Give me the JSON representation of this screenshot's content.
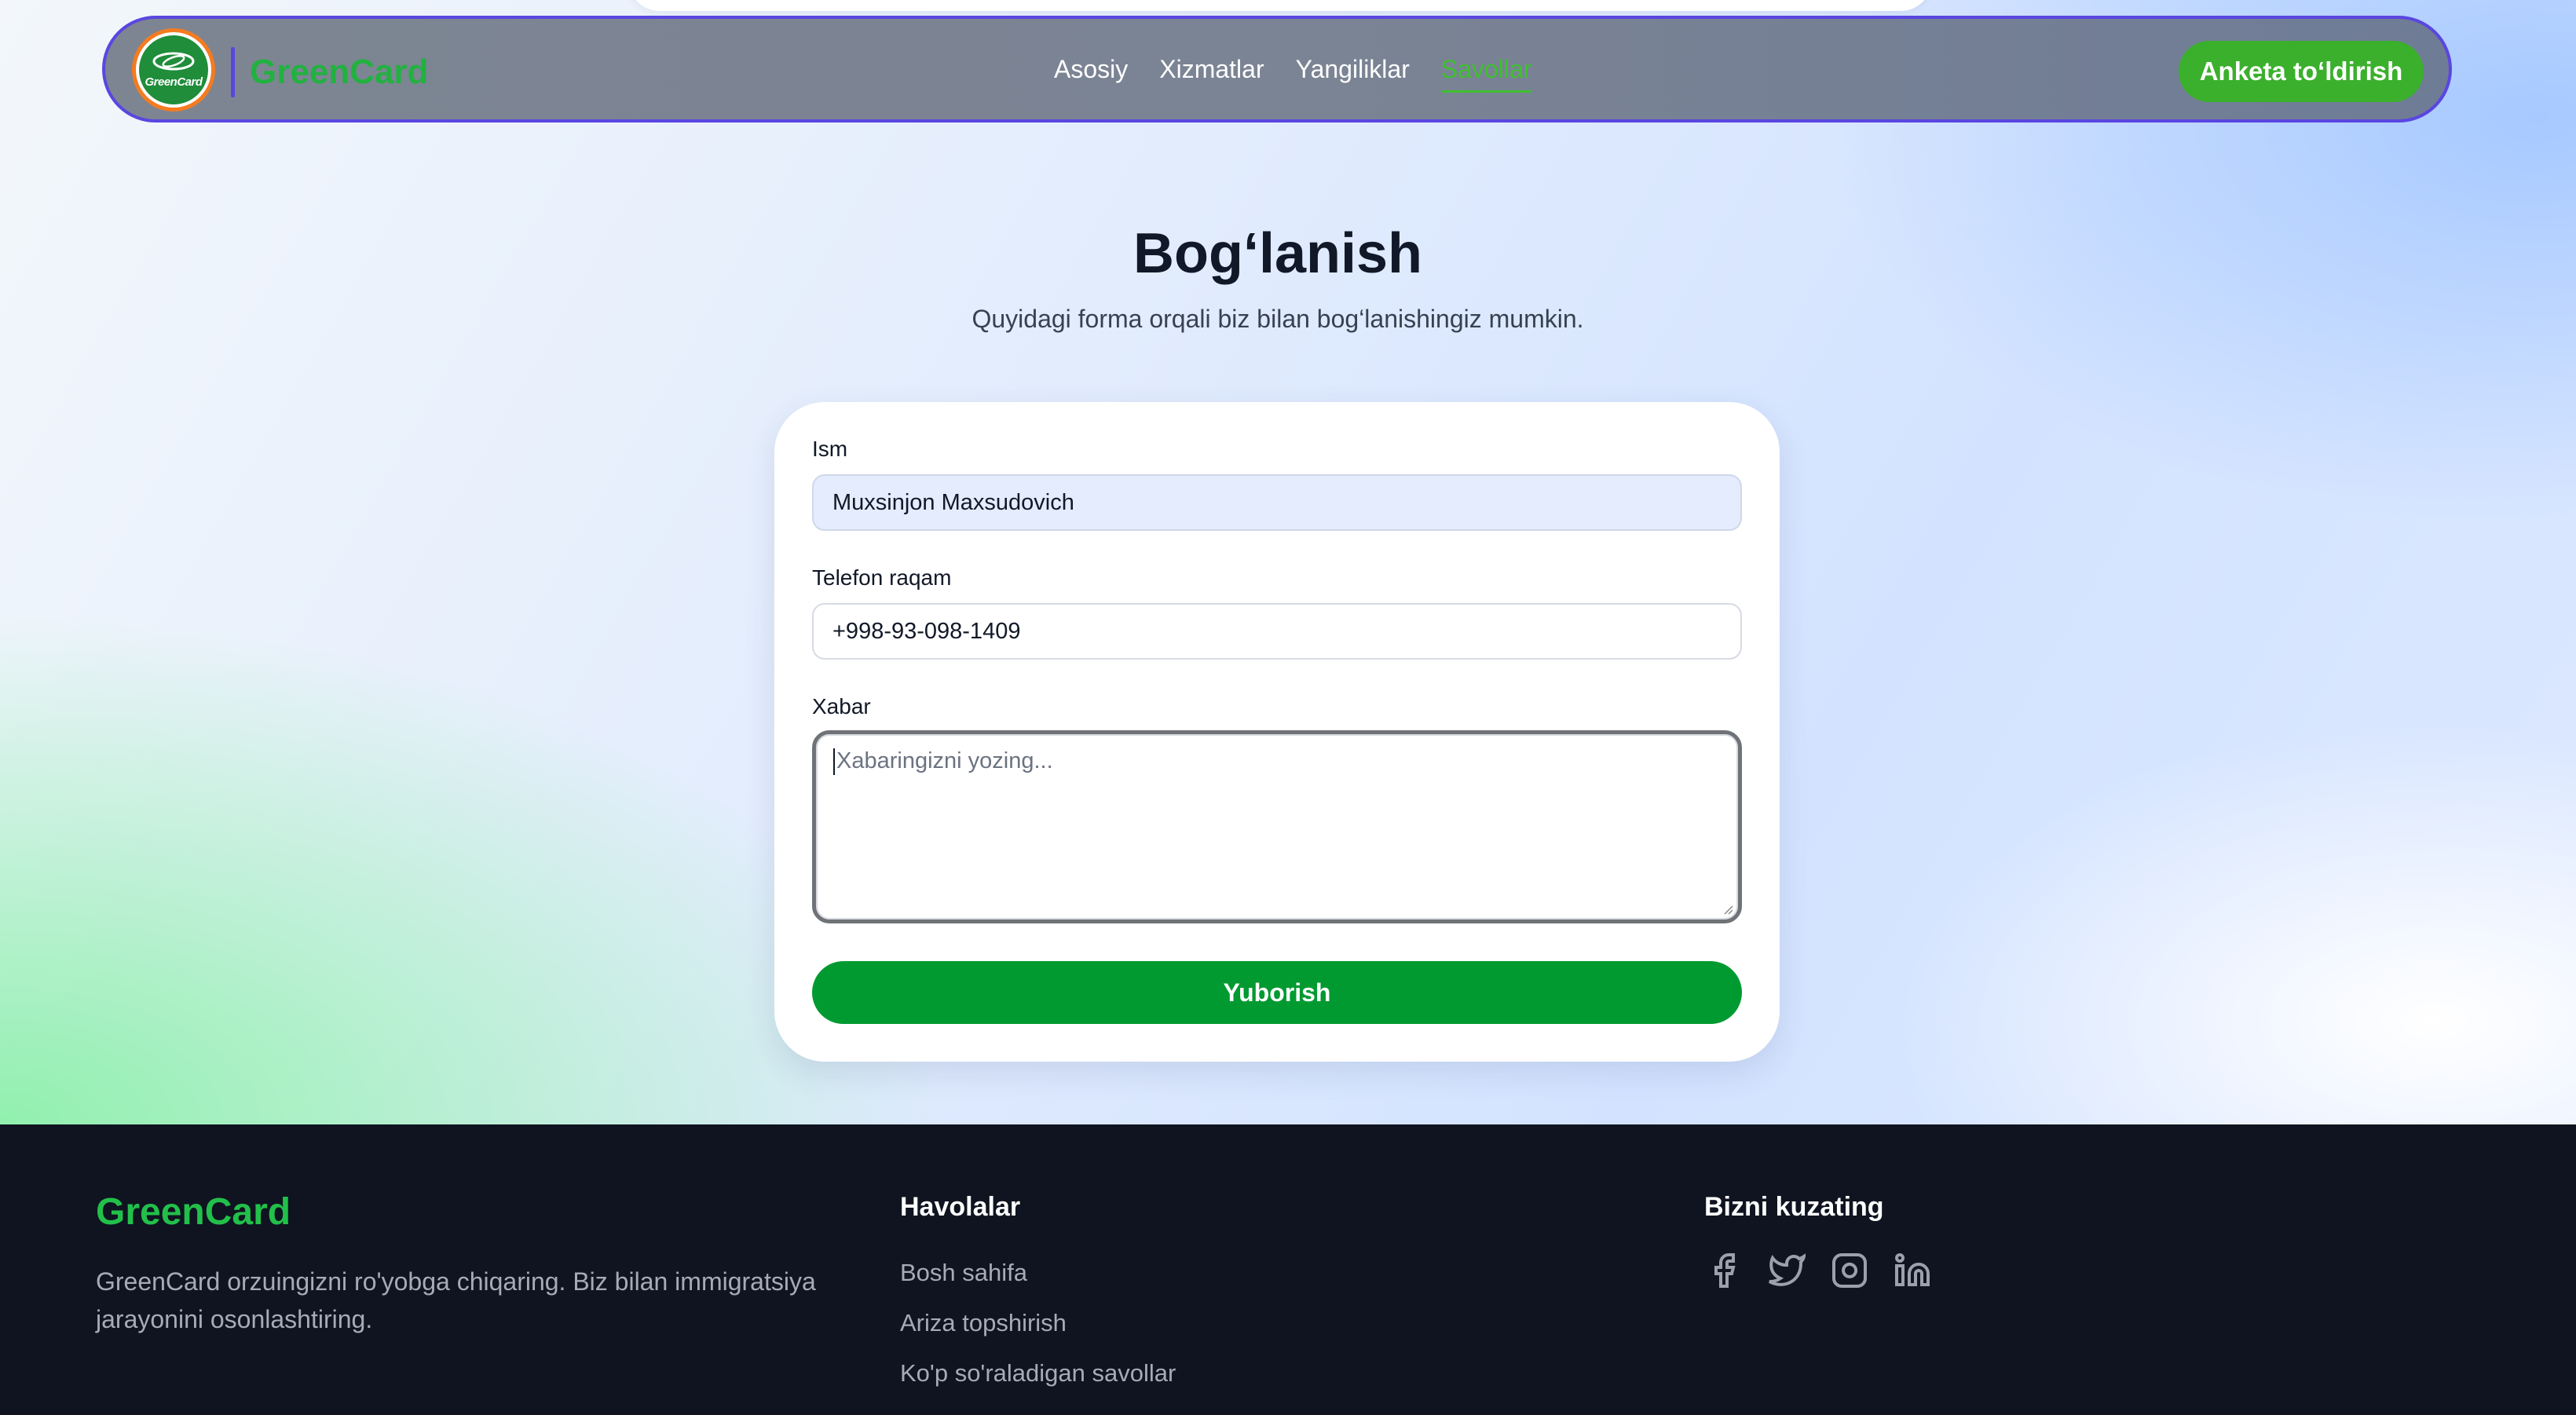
{
  "brand": {
    "name": "GreenCard",
    "logo_text": "GreenCard"
  },
  "nav": {
    "items": [
      {
        "label": "Asosiy",
        "active": false
      },
      {
        "label": "Xizmatlar",
        "active": false
      },
      {
        "label": "Yangiliklar",
        "active": false
      },
      {
        "label": "Savollar",
        "active": true
      }
    ],
    "cta_label": "Anketa to‘ldirish"
  },
  "contact": {
    "title": "Bog‘lanish",
    "subtitle": "Quyidagi forma orqali biz bilan bog‘lanishingiz mumkin.",
    "fields": {
      "name": {
        "label": "Ism",
        "value": "Muxsinjon Maxsudovich"
      },
      "phone": {
        "label": "Telefon raqam",
        "value": "+998-93-098-1409"
      },
      "message": {
        "label": "Xabar",
        "placeholder": "Xabaringizni yozing..."
      }
    },
    "submit_label": "Yuborish"
  },
  "footer": {
    "brand": "GreenCard",
    "description": "GreenCard orzuingizni ro'yobga chiqaring. Biz bilan immigratsiya jarayonini osonlashtiring.",
    "links_title": "Havolalar",
    "links": [
      "Bosh sahifa",
      "Ariza topshirish",
      "Ko'p so'raladigan savollar"
    ],
    "social_title": "Bizni kuzating",
    "social_icons": [
      "facebook-icon",
      "twitter-icon",
      "instagram-icon",
      "linkedin-icon"
    ]
  },
  "colors": {
    "brand_green": "#22b140",
    "cta_green": "#3bb02c",
    "submit_green": "#009a31",
    "nav_border": "#5a46e0",
    "footer_bg": "#0f1420"
  }
}
